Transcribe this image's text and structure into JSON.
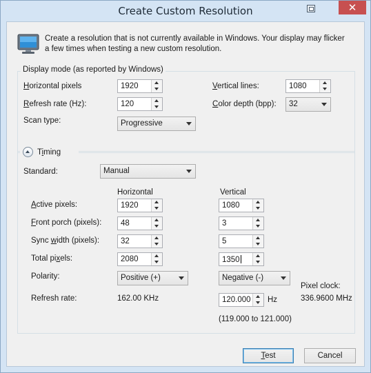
{
  "window": {
    "title": "Create Custom Resolution",
    "close_glyph": "✕"
  },
  "intro_text": "Create a resolution that is not currently available in Windows. Your display may flicker a few times when testing a new custom resolution.",
  "display_mode": {
    "group_label": "Display mode (as reported by Windows)",
    "horizontal_pixels": {
      "label_key": "H",
      "label_rest": "orizontal pixels",
      "value": "1920"
    },
    "refresh_rate": {
      "label_key": "R",
      "label_rest": "efresh rate (Hz):",
      "value": "120"
    },
    "scan_type": {
      "label": "Scan type:",
      "value": "Progressive"
    },
    "vertical_lines": {
      "label_key": "V",
      "label_rest": "ertical lines:",
      "value": "1080"
    },
    "color_depth": {
      "label_key": "C",
      "label_rest": "olor depth (bpp):",
      "value": "32"
    }
  },
  "timing": {
    "label_pre": "T",
    "label_key": "i",
    "label_post": "ming",
    "standard_label": "Standard:",
    "standard_value": "Manual",
    "col_horizontal": "Horizontal",
    "col_vertical": "Vertical",
    "rows": [
      {
        "label_pre": "",
        "label_key": "A",
        "label_post": "ctive pixels:",
        "h": "1920",
        "v": "1080"
      },
      {
        "label_pre": "",
        "label_key": "F",
        "label_post": "ront porch (pixels):",
        "h": "48",
        "v": "3"
      },
      {
        "label_pre": "Sync ",
        "label_key": "w",
        "label_post": "idth (pixels):",
        "h": "32",
        "v": "5"
      },
      {
        "label_pre": "Total pi",
        "label_key": "x",
        "label_post": "els:",
        "h": "2080",
        "v": "1350"
      }
    ],
    "polarity_label": "Polarity:",
    "polarity_h": "Positive (+)",
    "polarity_v": "Negative (-)",
    "refresh_label": "Refresh rate:",
    "refresh_h": "162.00 KHz",
    "refresh_v": "120.000",
    "refresh_unit": "Hz",
    "refresh_range": "(119.000 to 121.000)",
    "pixel_clock_label": "Pixel clock:",
    "pixel_clock_value": "336.9600 MHz"
  },
  "buttons": {
    "test_key": "T",
    "test_rest": "est",
    "cancel": "Cancel"
  },
  "icons": {
    "monitor": "monitor-icon",
    "expand": "collapse-arrow-icon",
    "dropdown": "chevron-down-icon"
  }
}
